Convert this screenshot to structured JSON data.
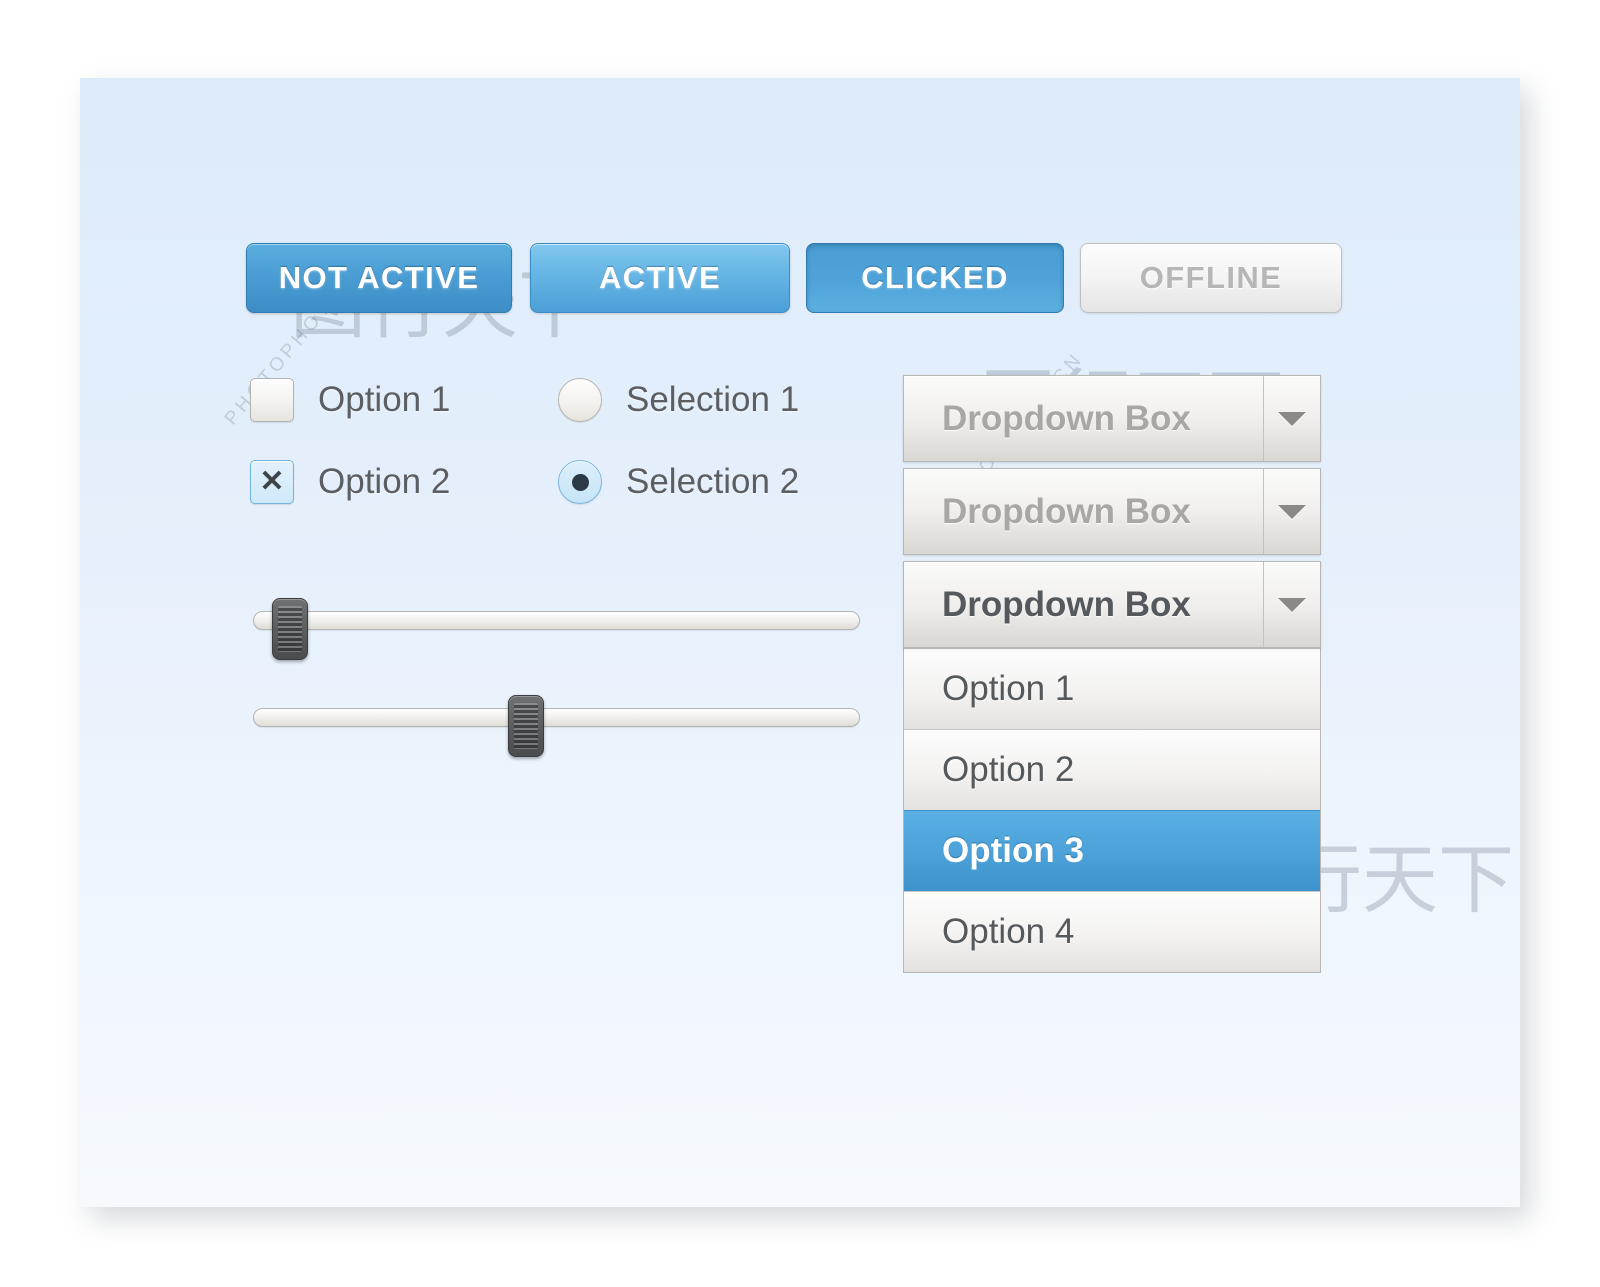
{
  "card": {
    "background_top": "#ddebfa",
    "background_bottom": "#f6fafe"
  },
  "buttons": [
    {
      "label": "NOT ACTIVE",
      "state": "not-active",
      "color": "#4a9ed4"
    },
    {
      "label": "ACTIVE",
      "state": "active",
      "color": "#68b7e6"
    },
    {
      "label": "CLICKED",
      "state": "clicked",
      "color": "#4fa3d8"
    },
    {
      "label": "OFFLINE",
      "state": "offline",
      "color": "#b6b6b6"
    }
  ],
  "checkboxes": [
    {
      "label": "Option 1",
      "checked": false,
      "mark": ""
    },
    {
      "label": "Option 2",
      "checked": true,
      "mark": "✕"
    }
  ],
  "radios": [
    {
      "label": "Selection 1",
      "selected": false
    },
    {
      "label": "Selection 2",
      "selected": true
    }
  ],
  "sliders": [
    {
      "name": "slider-1",
      "value_percent": 5
    },
    {
      "name": "slider-2",
      "value_percent": 44
    }
  ],
  "dropdowns": [
    {
      "label": "Dropdown Box",
      "state": "inactive",
      "open": false,
      "arrow": "chevron-down-icon"
    },
    {
      "label": "Dropdown Box",
      "state": "inactive",
      "open": false,
      "arrow": "chevron-down-icon"
    },
    {
      "label": "Dropdown Box",
      "state": "active",
      "open": true,
      "arrow": "chevron-down-icon",
      "options": [
        {
          "label": "Option 1",
          "selected": false
        },
        {
          "label": "Option 2",
          "selected": false
        },
        {
          "label": "Option 3",
          "selected": true
        },
        {
          "label": "Option 4",
          "selected": false
        }
      ],
      "selected_option": "Option 3",
      "highlight_color": "#4ba1d8"
    }
  ],
  "watermark": {
    "text_1": "PHOTOPHOTO.CN",
    "text_2": "PHOTOPHOTO.CN",
    "text_3": "PHOTOPHOTO.CN",
    "brush_1": "图行天下",
    "brush_2": "图行天下",
    "brush_3": "图行天下"
  }
}
